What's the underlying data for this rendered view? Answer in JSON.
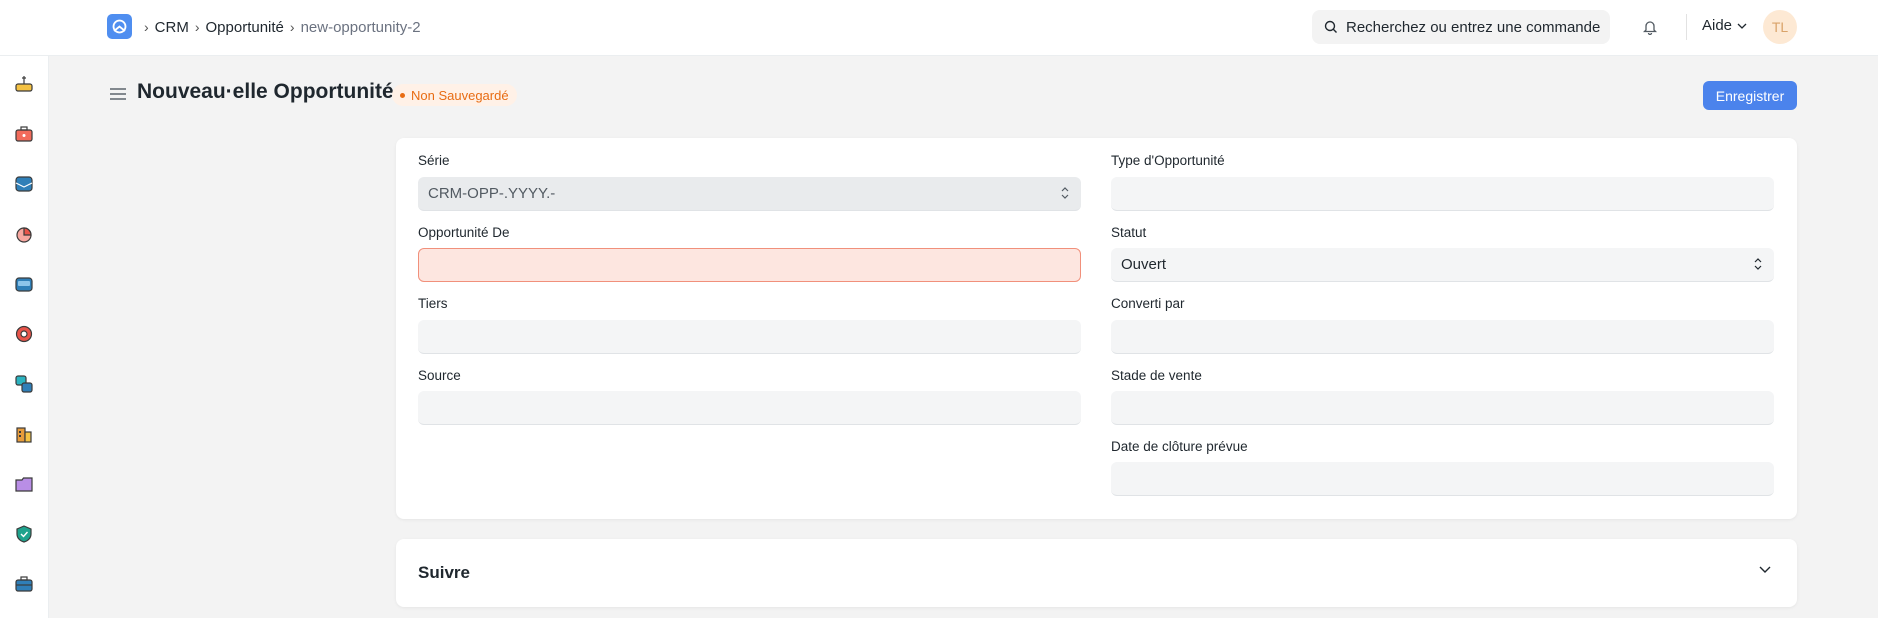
{
  "navbar": {
    "logo_icon": "app-logo-icon",
    "breadcrumb": [
      "CRM",
      "Opportunité",
      "new-opportunity-2"
    ],
    "search_placeholder": "Recherchez ou entrez une commande",
    "help_label": "Aide",
    "avatar_initials": "TL"
  },
  "sidebar": {
    "icons": [
      "home-icon",
      "briefcase-red-icon",
      "mail-icon",
      "pie-chart-icon",
      "inbox-icon",
      "lifebuoy-icon",
      "cards-icon",
      "buildings-icon",
      "folder-icon",
      "shield-icon",
      "toolbox-icon"
    ]
  },
  "header": {
    "title": "Nouveau·elle Opportunité",
    "status": "Non Sauvegardé",
    "save_label": "Enregistrer"
  },
  "form": {
    "left": [
      {
        "label": "Série",
        "value": "CRM-OPP-.YYYY.-"
      },
      {
        "label": "Opportunité De",
        "value": ""
      },
      {
        "label": "Tiers",
        "value": ""
      },
      {
        "label": "Source",
        "value": ""
      }
    ],
    "right": [
      {
        "label": "Type d'Opportunité",
        "value": ""
      },
      {
        "label": "Statut",
        "value": "Ouvert"
      },
      {
        "label": "Converti par",
        "value": ""
      },
      {
        "label": "Stade de vente",
        "value": ""
      },
      {
        "label": "Date de clôture prévue",
        "value": ""
      }
    ]
  },
  "section": {
    "title": "Suivre"
  },
  "colors": {
    "accent": "#4b83ec",
    "status_orange": "#e86c13",
    "error_bg": "#fde6e0"
  }
}
